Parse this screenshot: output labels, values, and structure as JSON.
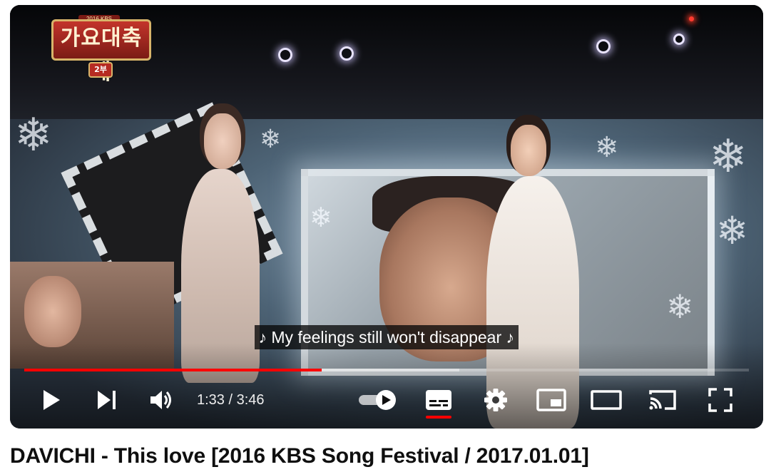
{
  "player": {
    "channel_logo": {
      "top_text": "2016 KBS",
      "main_text": "가요대축제",
      "sub_text": "2부"
    },
    "caption": "♪ My feelings still won't disappear ♪",
    "progress": {
      "played_fraction": 0.41,
      "buffered_fraction": 0.6
    },
    "controls": {
      "play_icon": "play-icon",
      "next_icon": "next-icon",
      "volume_icon": "volume-icon",
      "time_current": "1:33",
      "time_separator": "/",
      "time_total": "3:46",
      "time_display": "1:33 / 3:46",
      "autoplay_icon": "autoplay-toggle-icon",
      "autoplay_on": true,
      "subtitles_icon": "subtitles-icon",
      "subtitles_on": true,
      "settings_icon": "gear-icon",
      "miniplayer_icon": "miniplayer-icon",
      "theater_icon": "theater-mode-icon",
      "cast_icon": "cast-icon",
      "fullscreen_icon": "fullscreen-icon"
    },
    "colors": {
      "progress_played": "#ff0000",
      "subtitle_indicator": "#ff0000"
    }
  },
  "video": {
    "title": "DAVICHI - This love [2016 KBS Song Festival / 2017.01.01]"
  }
}
